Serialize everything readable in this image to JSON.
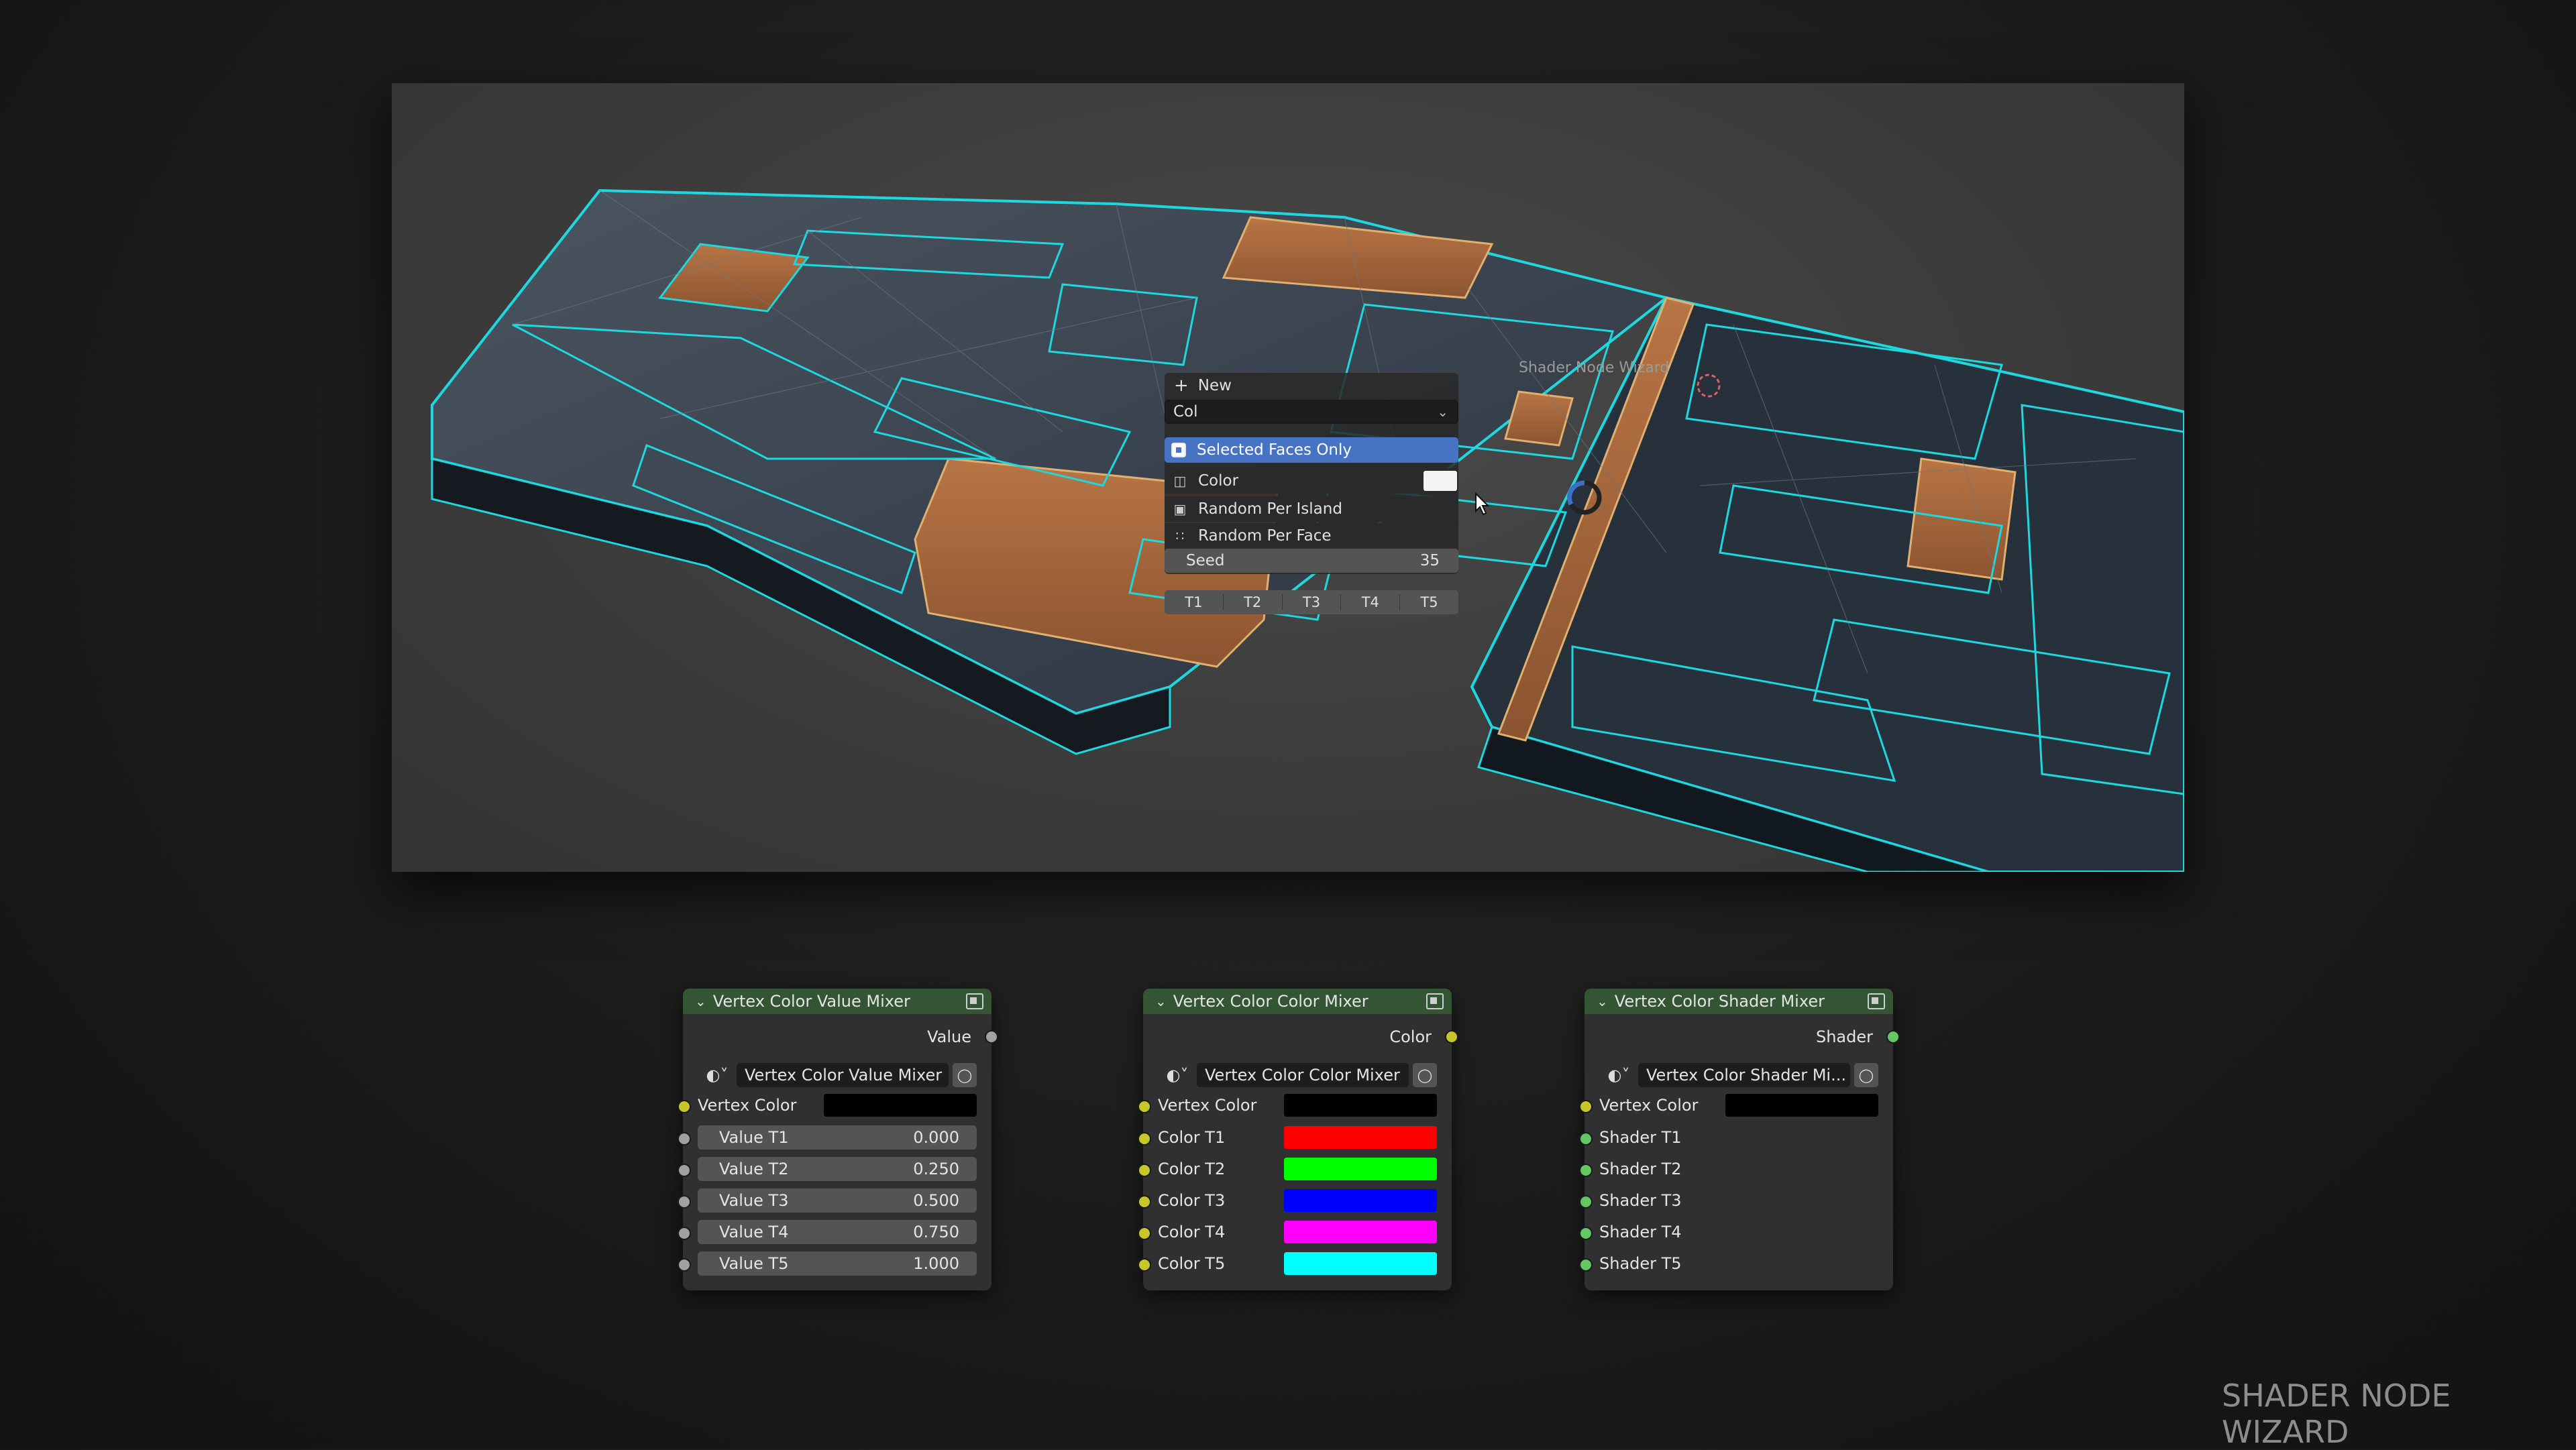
{
  "popup": {
    "new_label": "New",
    "attribute_value": "Col",
    "selected_faces_label": "Selected Faces Only",
    "color_label": "Color",
    "random_island_label": "Random Per Island",
    "random_face_label": "Random Per Face",
    "seed_label": "Seed",
    "seed_value": "35",
    "tabs": [
      "T1",
      "T2",
      "T3",
      "T4",
      "T5"
    ]
  },
  "viewport": {
    "addon_label": "Shader Node Wizard"
  },
  "nodes": [
    {
      "title": "Vertex Color Value Mixer",
      "output_label": "Value",
      "group_name": "Vertex Color Value Mixer",
      "vertex_color_label": "Vertex Color",
      "inputs": [
        {
          "label": "Value T1",
          "value": "0.000"
        },
        {
          "label": "Value T2",
          "value": "0.250"
        },
        {
          "label": "Value T3",
          "value": "0.500"
        },
        {
          "label": "Value T4",
          "value": "0.750"
        },
        {
          "label": "Value T5",
          "value": "1.000"
        }
      ]
    },
    {
      "title": "Vertex Color Color Mixer",
      "output_label": "Color",
      "group_name": "Vertex Color Color Mixer",
      "vertex_color_label": "Vertex Color",
      "inputs": [
        {
          "label": "Color T1",
          "color": "#ff0000"
        },
        {
          "label": "Color T2",
          "color": "#00ff00"
        },
        {
          "label": "Color T3",
          "color": "#0000ff"
        },
        {
          "label": "Color T4",
          "color": "#ff00ff"
        },
        {
          "label": "Color T5",
          "color": "#00ffff"
        }
      ]
    },
    {
      "title": "Vertex Color Shader Mixer",
      "output_label": "Shader",
      "group_name": "Vertex Color Shader Mi...",
      "vertex_color_label": "Vertex Color",
      "inputs": [
        {
          "label": "Shader T1"
        },
        {
          "label": "Shader T2"
        },
        {
          "label": "Shader T3"
        },
        {
          "label": "Shader T4"
        },
        {
          "label": "Shader T5"
        }
      ]
    }
  ],
  "brand": "SHADER NODE WIZARD",
  "colors": {
    "node_header": "#335533",
    "highlight": "#4673c4",
    "wire_cyan": "#1ed8e0",
    "face_orange": "#a0643a"
  }
}
